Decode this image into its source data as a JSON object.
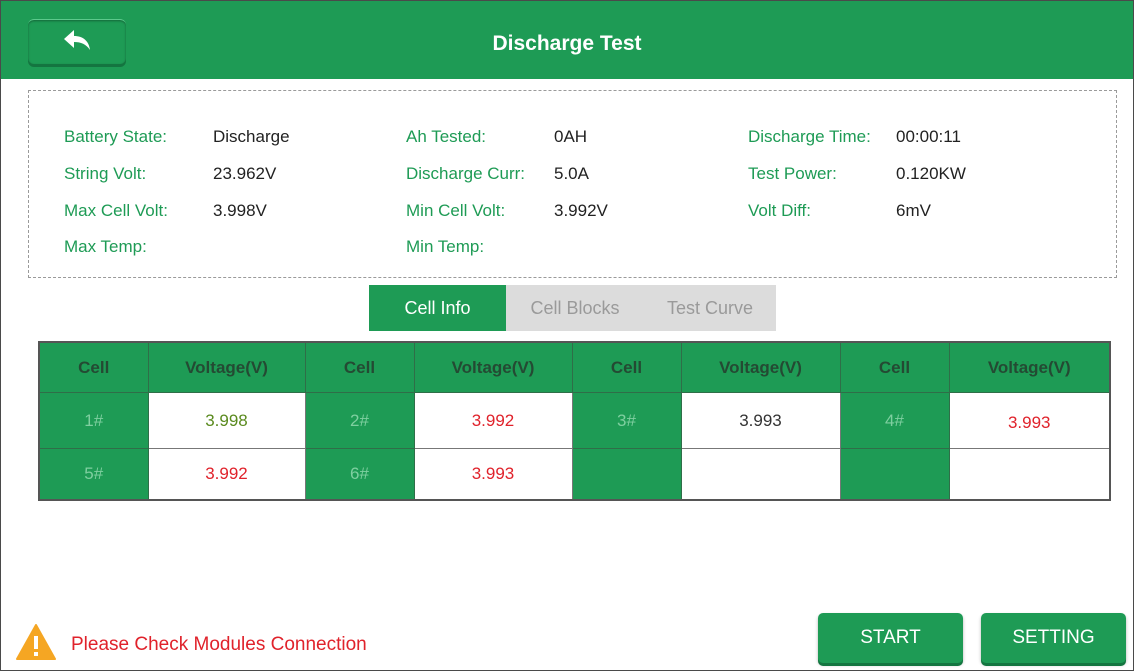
{
  "header": {
    "title": "Discharge Test",
    "back_icon": "back-arrow-icon"
  },
  "info": {
    "battery_state": {
      "label": "Battery State:",
      "value": "Discharge"
    },
    "string_volt": {
      "label": "String Volt:",
      "value": "23.962V"
    },
    "max_cell_volt": {
      "label": "Max Cell Volt:",
      "value": "3.998V"
    },
    "max_temp": {
      "label": "Max Temp:",
      "value": ""
    },
    "ah_tested": {
      "label": "Ah Tested:",
      "value": "0AH"
    },
    "discharge_curr": {
      "label": "Discharge Curr:",
      "value": "5.0A"
    },
    "min_cell_volt": {
      "label": "Min Cell Volt:",
      "value": "3.992V"
    },
    "min_temp": {
      "label": "Min Temp:",
      "value": ""
    },
    "discharge_time": {
      "label": "Discharge Time:",
      "value": "00:00:11"
    },
    "test_power": {
      "label": "Test Power:",
      "value": "0.120KW"
    },
    "volt_diff": {
      "label": "Volt Diff:",
      "value": "6mV"
    }
  },
  "tabs": [
    {
      "label": "Cell Info",
      "active": true
    },
    {
      "label": "Cell Blocks",
      "active": false
    },
    {
      "label": "Test Curve",
      "active": false
    }
  ],
  "table": {
    "headers": [
      "Cell",
      "Voltage(V)",
      "Cell",
      "Voltage(V)",
      "Cell",
      "Voltage(V)",
      "Cell",
      "Voltage(V)"
    ],
    "rows": [
      [
        {
          "cell": "1#",
          "voltage": "3.998",
          "color": "#5a8a1e"
        },
        {
          "cell": "2#",
          "voltage": "3.992",
          "color": "#e0222b"
        },
        {
          "cell": "3#",
          "voltage": "3.993",
          "color": "#333333"
        },
        {
          "cell": "4#",
          "voltage": "3.993",
          "color": "#e0222b"
        }
      ],
      [
        {
          "cell": "5#",
          "voltage": "3.992",
          "color": "#e0222b"
        },
        {
          "cell": "6#",
          "voltage": "3.993",
          "color": "#e0222b"
        },
        {
          "cell": "",
          "voltage": "",
          "color": "#333333"
        },
        {
          "cell": "",
          "voltage": "",
          "color": "#333333"
        }
      ]
    ]
  },
  "footer": {
    "warning_icon": "warning-icon",
    "warning_text": "Please Check Modules Connection",
    "start_label": "START",
    "setting_label": "SETTING"
  },
  "colors": {
    "primary_green": "#1e9b55",
    "label_green": "#1e9b55",
    "warning_red": "#e0222b",
    "warning_orange": "#f5a623"
  }
}
